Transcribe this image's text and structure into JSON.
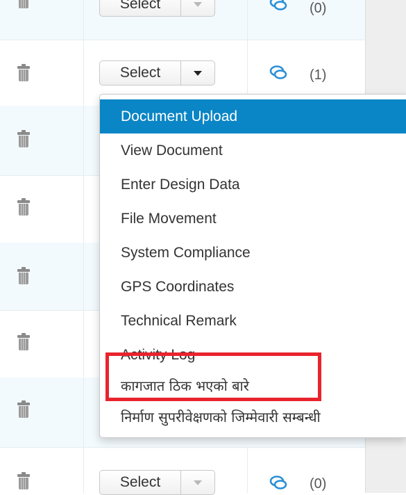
{
  "rows": [
    {
      "select_label": "Select",
      "comment_count": "(0)"
    },
    {
      "select_label": "Select",
      "comment_count": "(1)"
    },
    {
      "select_label": "Select",
      "comment_count": "(0)"
    }
  ],
  "dropdown": {
    "items": [
      {
        "label": "Document Upload"
      },
      {
        "label": "View Document"
      },
      {
        "label": "Enter Design Data"
      },
      {
        "label": "File Movement"
      },
      {
        "label": "System Compliance"
      },
      {
        "label": "GPS Coordinates"
      },
      {
        "label": "Technical Remark"
      },
      {
        "label": "Activity Log"
      },
      {
        "label": "कागजात ठिक भएको बारे"
      },
      {
        "label": "निर्माण सुपरीवेक्षणको जिम्मेवारी सम्बन्धी"
      }
    ]
  },
  "colors": {
    "active_item": "#0a85c5",
    "highlight_box": "#e8232c",
    "chat_icon": "#2a8fd6"
  },
  "icons": [
    "trash-icon",
    "chevron-down-icon",
    "comment-icon"
  ]
}
